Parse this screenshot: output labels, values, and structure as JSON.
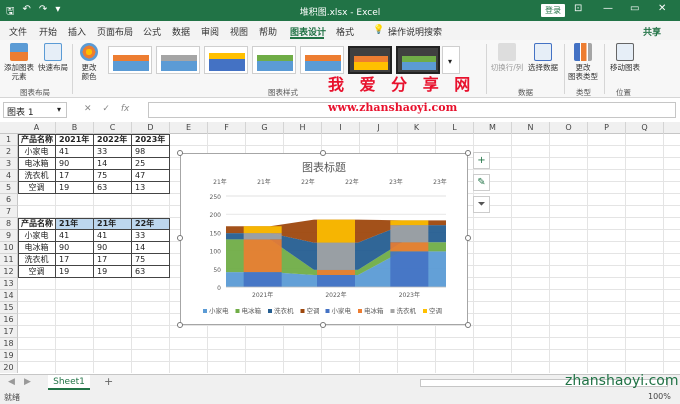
{
  "window": {
    "title": "堆积图.xlsx  -  Excel",
    "login_label": "登录",
    "minimize": "—",
    "restore": "▭",
    "close": "✕"
  },
  "menu": {
    "tabs": [
      {
        "label": "文件",
        "active": false
      },
      {
        "label": "开始",
        "active": false
      },
      {
        "label": "插入",
        "active": false
      },
      {
        "label": "页面布局",
        "active": false
      },
      {
        "label": "公式",
        "active": false
      },
      {
        "label": "数据",
        "active": false
      },
      {
        "label": "审阅",
        "active": false
      },
      {
        "label": "视图",
        "active": false
      },
      {
        "label": "帮助",
        "active": false
      },
      {
        "label": "图表设计",
        "active": true
      },
      {
        "label": "格式",
        "active": false
      }
    ],
    "tell_me": "操作说明搜索",
    "share": "共享"
  },
  "ribbon": {
    "add_element": "添加图表\n元素",
    "quick_layout": "快速布局",
    "change_colors": "更改\n颜色",
    "switch_row_col": "切换行/列",
    "select_data": "选择数据",
    "change_type": "更改\n图表类型",
    "move_chart": "移动图表",
    "groups": {
      "layout": "图表布局",
      "styles": "图表样式",
      "data": "数据",
      "type": "类型",
      "location": "位置"
    }
  },
  "watermark": {
    "title": "我 爱 分 享 网",
    "url": "www.zhanshaoyi.com",
    "url2": "zhanshaoyi.com"
  },
  "formula_bar": {
    "name_box": "图表 1",
    "cancel": "✕",
    "enter": "✓",
    "fx": "fx",
    "value": ""
  },
  "sheet": {
    "columns": [
      "A",
      "B",
      "C",
      "D",
      "E",
      "F",
      "G",
      "H",
      "I",
      "J",
      "K",
      "L",
      "M",
      "N",
      "O",
      "P",
      "Q"
    ],
    "rows": [
      "1",
      "2",
      "3",
      "4",
      "5",
      "6",
      "7",
      "8",
      "9",
      "10",
      "11",
      "12",
      "13",
      "14",
      "15",
      "16",
      "17",
      "18",
      "19",
      "20"
    ],
    "table1": {
      "header": [
        "产品名称",
        "2021年",
        "2022年",
        "2023年"
      ],
      "rows": [
        [
          "小家电",
          "41",
          "33",
          "98"
        ],
        [
          "电冰箱",
          "90",
          "14",
          "25"
        ],
        [
          "洗衣机",
          "17",
          "75",
          "47"
        ],
        [
          "空调",
          "19",
          "63",
          "13"
        ]
      ]
    },
    "table2": {
      "header": [
        "产品名称",
        "21年",
        "21年",
        "22年"
      ],
      "rows": [
        [
          "小家电",
          "41",
          "41",
          "33"
        ],
        [
          "电冰箱",
          "90",
          "90",
          "14"
        ],
        [
          "洗衣机",
          "17",
          "17",
          "75"
        ],
        [
          "空调",
          "19",
          "19",
          "63"
        ]
      ]
    }
  },
  "chart_data": {
    "type": "area",
    "title": "图表标题",
    "top_axis_labels": [
      "21年",
      "21年",
      "22年",
      "22年",
      "23年",
      "23年"
    ],
    "x_labels": [
      "2021年",
      "2022年",
      "2023年"
    ],
    "ylim": [
      0,
      250
    ],
    "yticks": [
      0,
      50,
      100,
      150,
      200,
      250
    ],
    "grid": true,
    "legend_position": "bottom",
    "stacked_area_series": [
      {
        "name": "小家电",
        "color": "#5b9bd5",
        "values": [
          41,
          41,
          33,
          33,
          98,
          98
        ]
      },
      {
        "name": "电冰箱",
        "color": "#70ad47",
        "values": [
          90,
          90,
          14,
          14,
          25,
          25
        ]
      },
      {
        "name": "洗衣机",
        "color": "#255e91",
        "values": [
          17,
          17,
          75,
          75,
          47,
          47
        ]
      },
      {
        "name": "空调",
        "color": "#9e480e",
        "values": [
          19,
          19,
          63,
          63,
          13,
          13
        ]
      }
    ],
    "stacked_bar_series": [
      {
        "name": "小家电",
        "color": "#4472c4",
        "values": [
          41,
          33,
          98
        ]
      },
      {
        "name": "电冰箱",
        "color": "#ed7d31",
        "values": [
          90,
          14,
          25
        ]
      },
      {
        "name": "洗衣机",
        "color": "#a5a5a5",
        "values": [
          17,
          75,
          47
        ]
      },
      {
        "name": "空调",
        "color": "#ffc000",
        "values": [
          19,
          63,
          13
        ]
      }
    ]
  },
  "sheet_tabs": {
    "active": "Sheet1",
    "add": "+"
  },
  "status": {
    "ready": "就绪",
    "zoom": "100%"
  }
}
